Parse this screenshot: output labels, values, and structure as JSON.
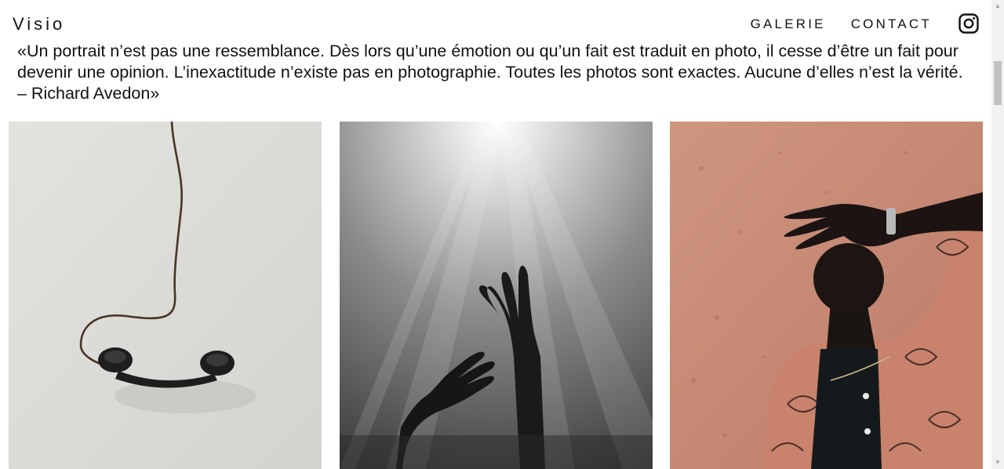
{
  "header": {
    "brand": "Visio",
    "nav": [
      {
        "label": "GALERIE"
      },
      {
        "label": "CONTACT"
      }
    ],
    "social_icon": "instagram-icon"
  },
  "quote": {
    "text": "«Un portrait n’est pas une ressemblance. Dès lors qu’une émotion ou qu’un fait est traduit en photo, il cesse d’être un fait pour devenir une opinion. L’inexactitude n’existe pas en photographie. Toutes les photos sont exactes. Aucune d’elles n’est la vérité. – Richard Avedon»"
  },
  "gallery": {
    "photos": [
      {
        "subject": "hanging-telephone-receiver"
      },
      {
        "subject": "hands-reaching-toward-light"
      },
      {
        "subject": "man-shading-face-against-sand-wall"
      }
    ]
  },
  "colors": {
    "text": "#111111",
    "background": "#ffffff",
    "photo1_bg": "#dcdcd8",
    "photo3_sand": "#c98d77"
  }
}
